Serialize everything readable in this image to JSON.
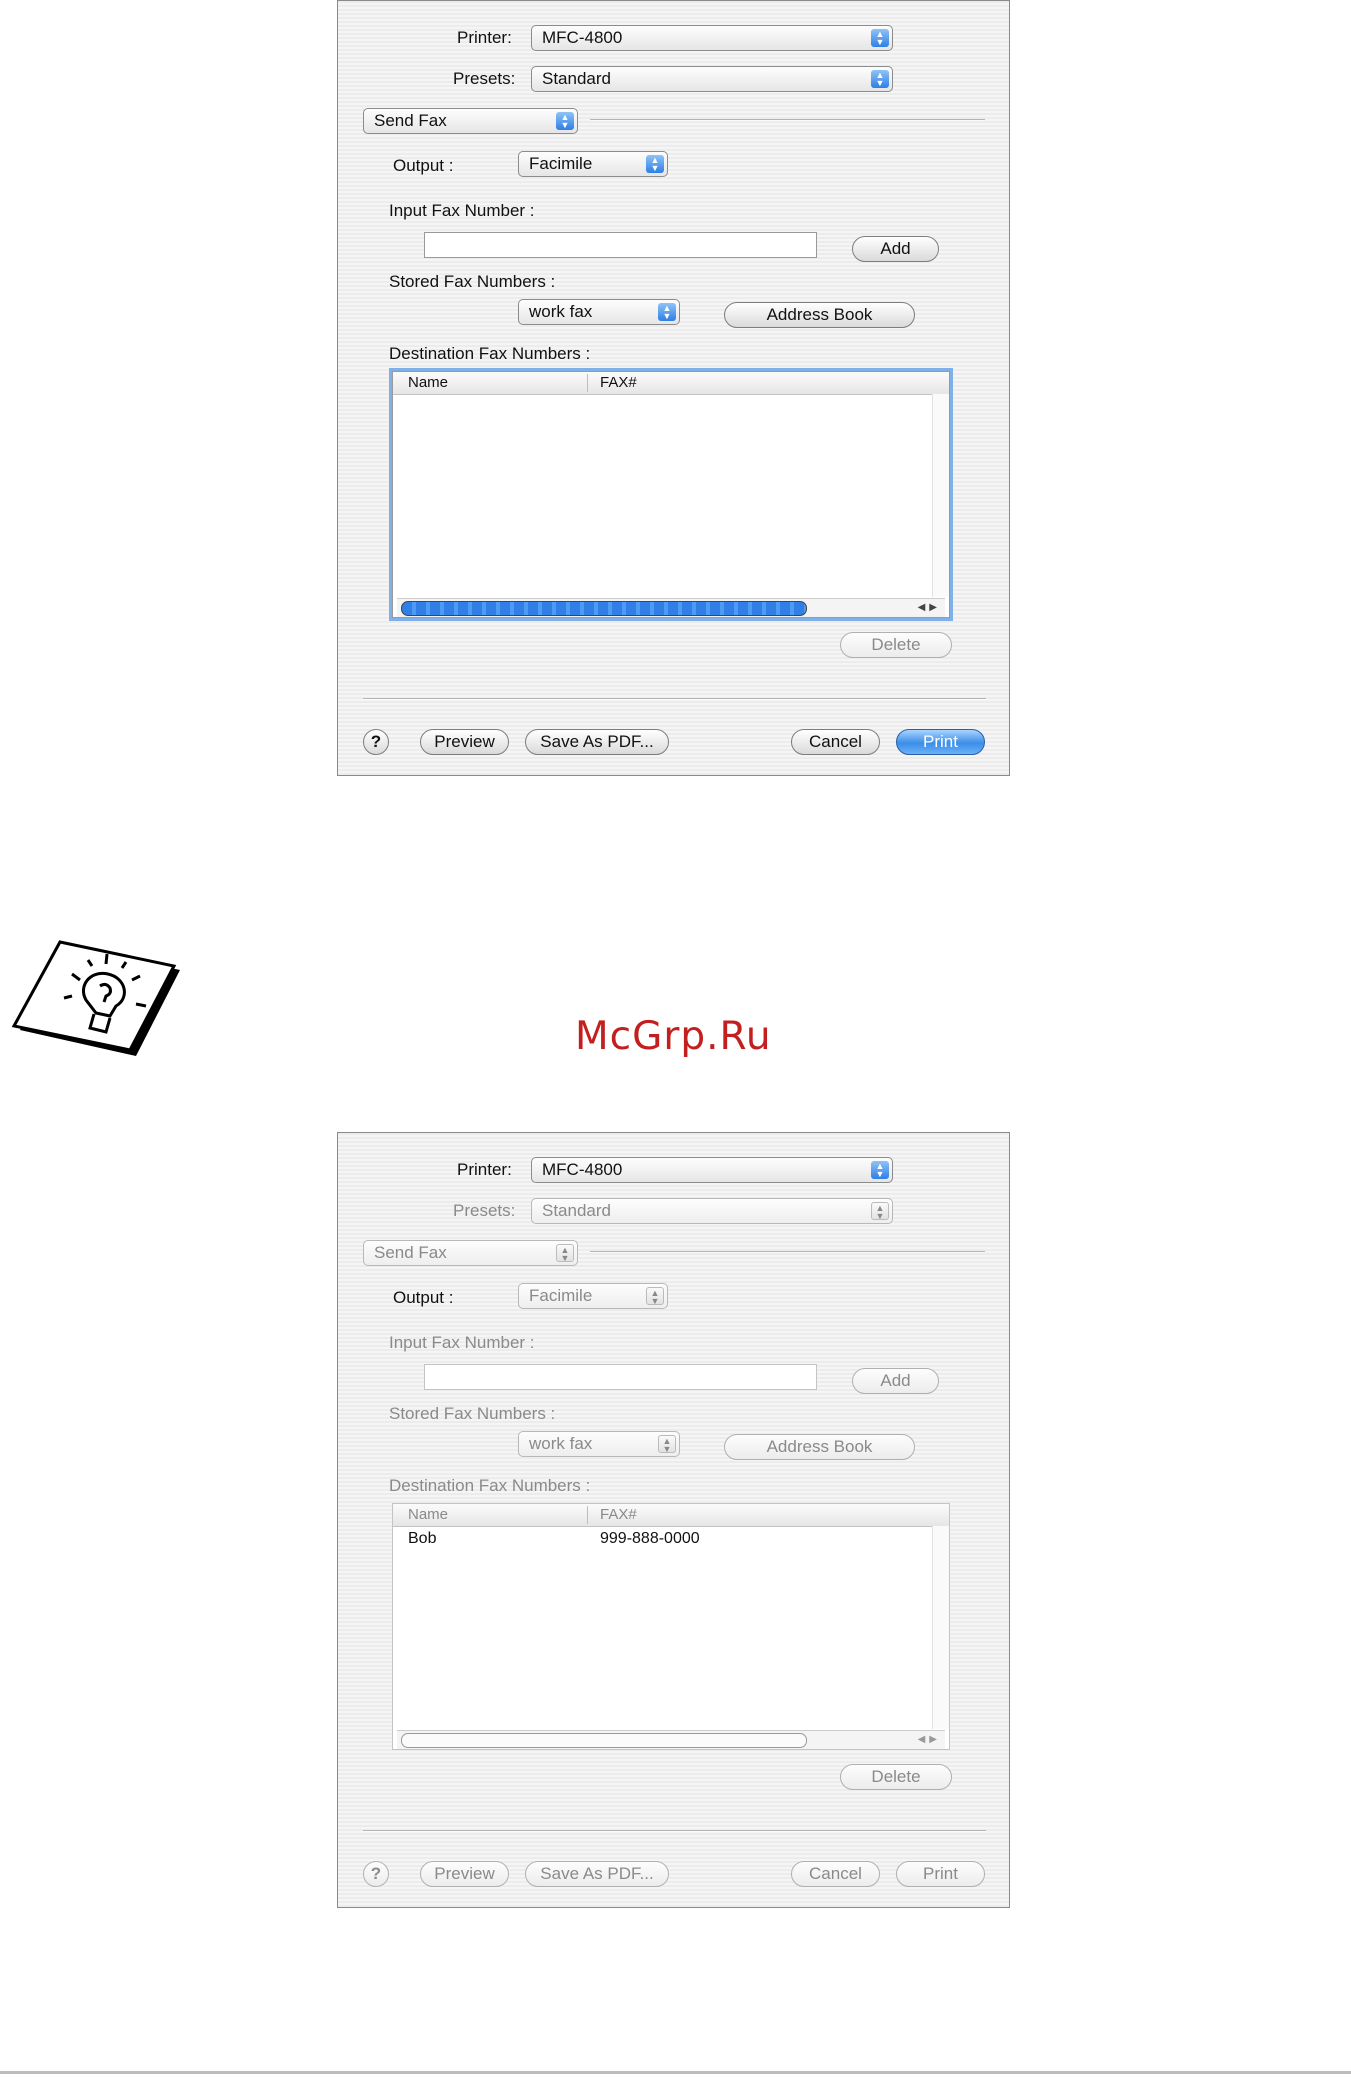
{
  "dialog_active": {
    "printer_label": "Printer:",
    "printer_value": "MFC-4800",
    "presets_label": "Presets:",
    "presets_value": "Standard",
    "panel_value": "Send Fax",
    "output_label": "Output :",
    "output_value": "Facimile",
    "input_fax_label": "Input Fax Number :",
    "input_fax_value": "",
    "add_button": "Add",
    "stored_label": "Stored Fax Numbers :",
    "stored_value": "work fax",
    "address_book_button": "Address Book",
    "destination_label": "Destination Fax Numbers :",
    "columns": [
      "Name",
      "FAX#"
    ],
    "rows": [],
    "delete_button": "Delete",
    "help_button": "?",
    "preview_button": "Preview",
    "save_pdf_button": "Save As PDF...",
    "cancel_button": "Cancel",
    "print_button": "Print"
  },
  "watermark": "McGrp.Ru",
  "dialog_disabled": {
    "printer_label": "Printer:",
    "printer_value": "MFC-4800",
    "presets_label": "Presets:",
    "presets_value": "Standard",
    "panel_value": "Send Fax",
    "output_label": "Output :",
    "output_value": "Facimile",
    "input_fax_label": "Input Fax Number :",
    "input_fax_value": "",
    "add_button": "Add",
    "stored_label": "Stored Fax Numbers :",
    "stored_value": "work fax",
    "address_book_button": "Address Book",
    "destination_label": "Destination Fax Numbers :",
    "columns": [
      "Name",
      "FAX#"
    ],
    "rows": [
      {
        "name": "Bob",
        "fax": "999-888-0000"
      }
    ],
    "delete_button": "Delete",
    "help_button": "?",
    "preview_button": "Preview",
    "save_pdf_button": "Save As PDF...",
    "cancel_button": "Cancel",
    "print_button": "Print"
  },
  "icons": {
    "tip": "lightbulb-tip-icon",
    "popup_arrows": "up-down-arrows-icon",
    "scroll_arrows": "left-right-arrows-icon"
  }
}
